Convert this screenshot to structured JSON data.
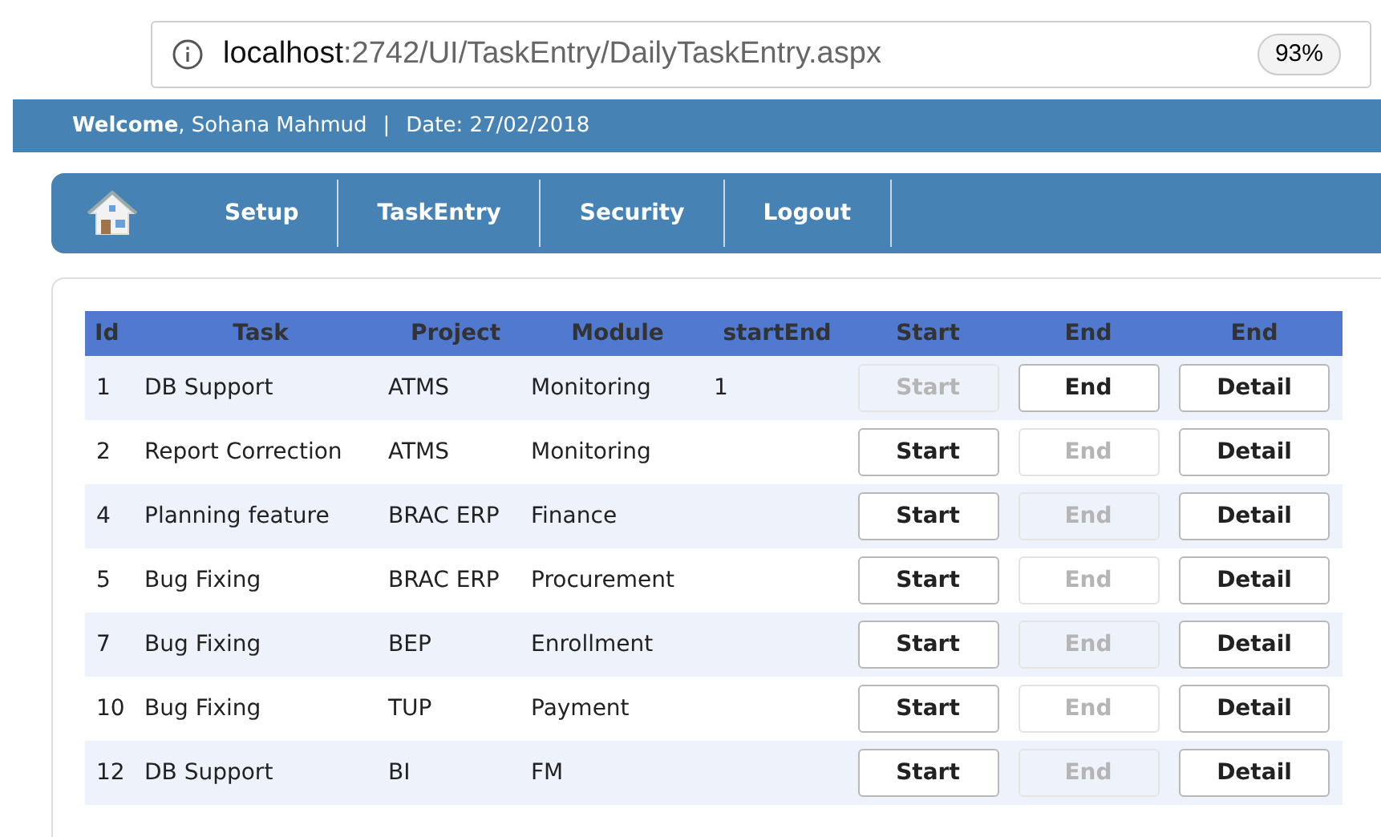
{
  "address_bar": {
    "host": "localhost",
    "path": ":2742/UI/TaskEntry/DailyTaskEntry.aspx",
    "zoom": "93%"
  },
  "banner": {
    "welcome": "Welcome",
    "user": ", Sohana Mahmud",
    "separator": "|",
    "date": "Date: 27/02/2018"
  },
  "nav": [
    "Setup",
    "TaskEntry",
    "Security",
    "Logout"
  ],
  "table": {
    "columns": [
      "Id",
      "Task",
      "Project",
      "Module",
      "startEnd",
      "Start",
      "End",
      "End"
    ],
    "rows": [
      {
        "id": "1",
        "task": "DB Support",
        "project": "ATMS",
        "module": "Monitoring",
        "start_end": "1",
        "start": {
          "label": "Start",
          "disabled": true
        },
        "end": {
          "label": "End",
          "disabled": false
        },
        "detail": "Detail"
      },
      {
        "id": "2",
        "task": "Report Correction",
        "project": "ATMS",
        "module": "Monitoring",
        "start": {
          "label": "Start",
          "disabled": false
        },
        "end": {
          "label": "End",
          "disabled": true
        },
        "detail": "Detail"
      },
      {
        "id": "4",
        "task": "Planning feature",
        "project": "BRAC ERP",
        "module": "Finance",
        "start": {
          "label": "Start",
          "disabled": false
        },
        "end": {
          "label": "End",
          "disabled": true
        },
        "detail": "Detail"
      },
      {
        "id": "5",
        "task": "Bug Fixing",
        "project": "BRAC ERP",
        "module": "Procurement",
        "start": {
          "label": "Start",
          "disabled": false
        },
        "end": {
          "label": "End",
          "disabled": true
        },
        "detail": "Detail"
      },
      {
        "id": "7",
        "task": "Bug Fixing",
        "project": "BEP",
        "module": "Enrollment",
        "start": {
          "label": "Start",
          "disabled": false
        },
        "end": {
          "label": "End",
          "disabled": true
        },
        "detail": "Detail"
      },
      {
        "id": "10",
        "task": "Bug Fixing",
        "project": "TUP",
        "module": "Payment",
        "start": {
          "label": "Start",
          "disabled": false
        },
        "end": {
          "label": "End",
          "disabled": true
        },
        "detail": "Detail"
      },
      {
        "id": "12",
        "task": "DB Support",
        "project": "BI",
        "module": "FM",
        "start": {
          "label": "Start",
          "disabled": false
        },
        "end": {
          "label": "End",
          "disabled": true
        },
        "detail": "Detail"
      }
    ]
  }
}
